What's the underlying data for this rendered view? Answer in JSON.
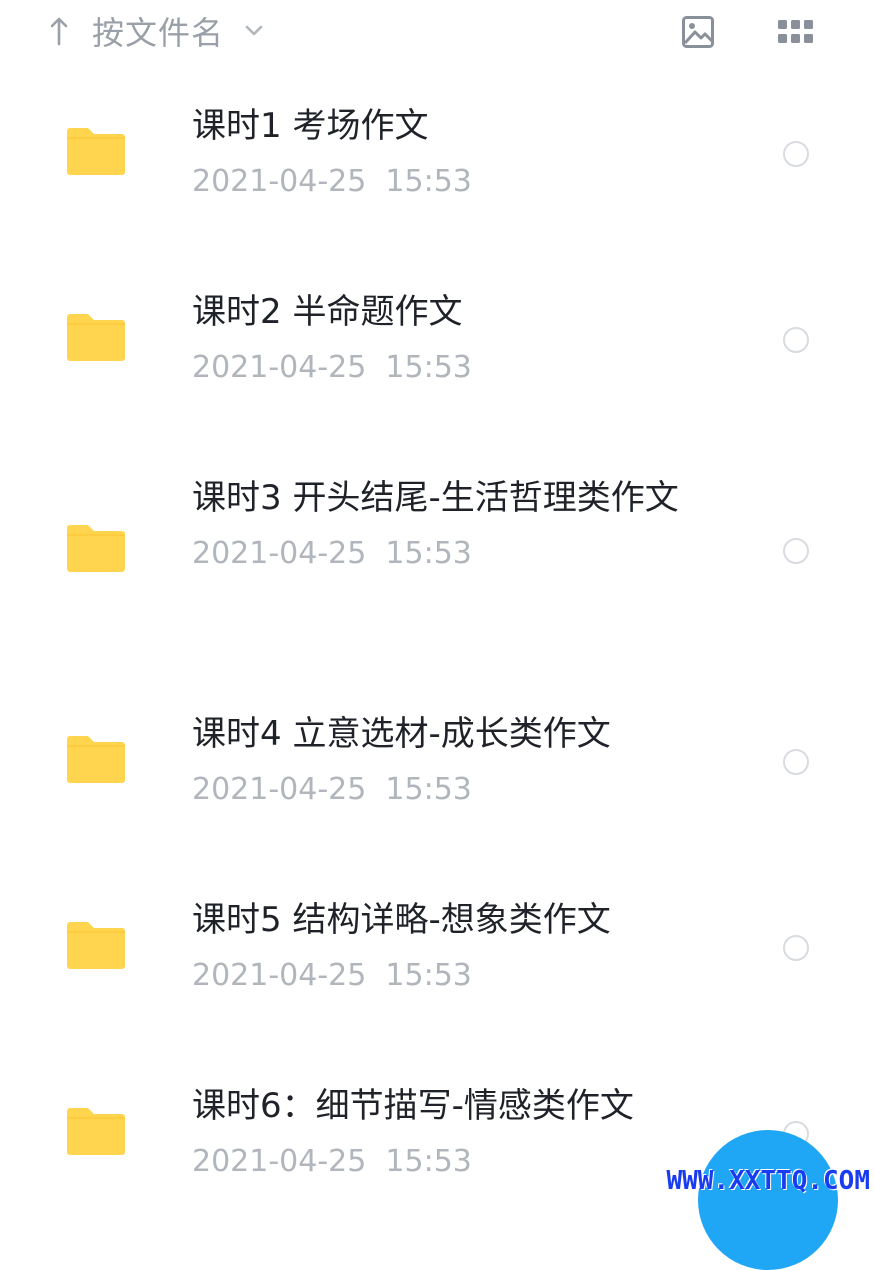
{
  "toolbar": {
    "sort_label": "按文件名",
    "sort_direction_icon": "arrow-up-icon",
    "sort_dropdown_icon": "chevron-down-icon",
    "image_view_icon": "image-icon",
    "grid_view_icon": "grid-icon"
  },
  "files": [
    {
      "name": "课时1 考场作文",
      "date": "2021-04-25  15:53"
    },
    {
      "name": "课时2 半命题作文",
      "date": "2021-04-25  15:53"
    },
    {
      "name": "课时3 开头结尾-生活哲理类作文",
      "date": "2021-04-25  15:53"
    },
    {
      "name": "课时4 立意选材-成长类作文",
      "date": "2021-04-25  15:53"
    },
    {
      "name": "课时5 结构详略-想象类作文",
      "date": "2021-04-25  15:53"
    },
    {
      "name": "课时6：细节描写-情感类作文",
      "date": "2021-04-25  15:53"
    }
  ],
  "watermark": "WWW.XXTTQ.COM",
  "colors": {
    "folder": "#FFD54F",
    "accent": "#1FA6F5",
    "secondary_text": "#B1B5BC"
  }
}
